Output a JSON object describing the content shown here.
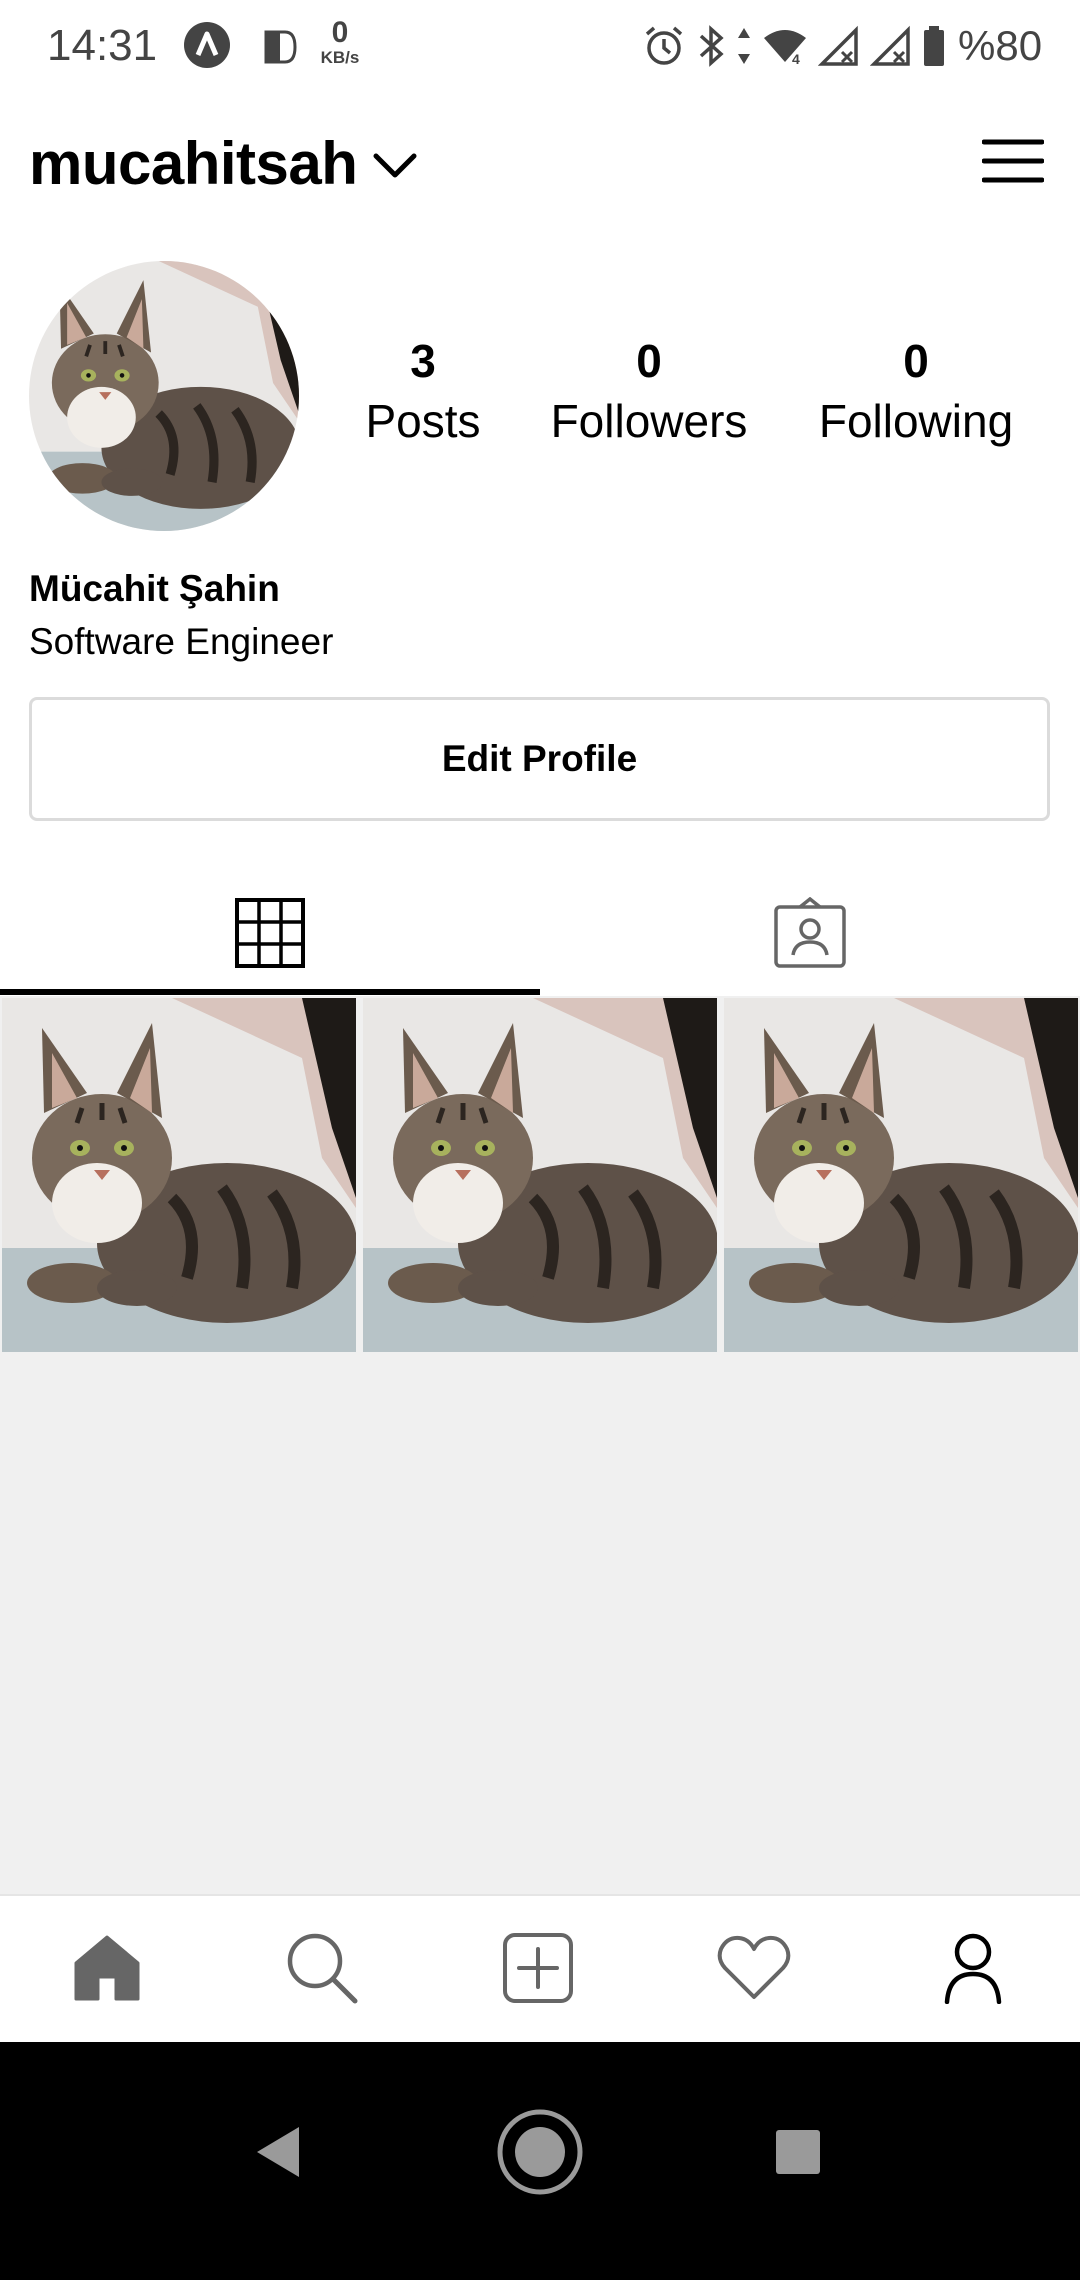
{
  "status_bar": {
    "time": "14:31",
    "network_speed_value": "0",
    "network_speed_unit": "KB/s",
    "battery_percent": "%80",
    "icons": [
      "app-a-icon",
      "document-icon",
      "alarm-icon",
      "bluetooth-icon",
      "data-arrows-icon",
      "wifi-icon",
      "signal-icon",
      "signal-icon",
      "battery-icon"
    ]
  },
  "header": {
    "username": "mucahitsah",
    "dropdown_icon": "chevron-down-icon",
    "menu_icon": "hamburger-menu-icon"
  },
  "profile": {
    "stats": [
      {
        "count": "3",
        "label": "Posts"
      },
      {
        "count": "0",
        "label": "Followers"
      },
      {
        "count": "0",
        "label": "Following"
      }
    ],
    "full_name": "Mücahit Şahin",
    "bio": "Software Engineer",
    "edit_button_label": "Edit Profile"
  },
  "tabs": [
    {
      "icon": "grid-icon",
      "active": true
    },
    {
      "icon": "tagged-photos-icon",
      "active": false
    }
  ],
  "posts_count_shown": 3,
  "bottom_nav": [
    "home-icon",
    "search-icon",
    "add-post-icon",
    "heart-icon",
    "profile-icon"
  ],
  "colors": {
    "background": "#ffffff",
    "grid_background": "#f0f0f0",
    "text": "#000000",
    "status_text": "#444444",
    "border": "#dbdbdb",
    "nav_bar": "#000000"
  }
}
